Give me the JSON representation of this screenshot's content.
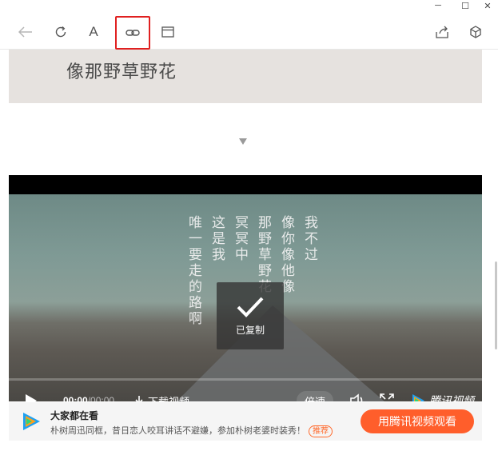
{
  "titlebar": {
    "minimize_glyph": "─",
    "maximize_glyph": "☐",
    "close_glyph": "✕"
  },
  "toolbar": {
    "back_icon": "arrow-left-icon",
    "refresh_icon": "refresh-icon",
    "font_label": "A",
    "link_icon": "link-icon",
    "window_icon": "window-icon",
    "share_icon": "share-icon",
    "cube_icon": "cube-icon",
    "highlight_color": "#e02020"
  },
  "article": {
    "banner_text": "像那野草野花"
  },
  "video": {
    "lyrics": [
      "我不过",
      "像你像他像",
      "那野草野花",
      "冥冥中",
      "这是我",
      "唯一要走的路啊"
    ],
    "toast_text": "已复制",
    "time_current": "00:00",
    "time_sep": "/",
    "time_total": "00:00",
    "download_label": "下载视频",
    "speed_label": "倍速",
    "brand_label": "腾讯视频"
  },
  "promo": {
    "title": "大家都在看",
    "description": "朴树周迅同框，昔日恋人咬耳讲话不避嫌，参加朴树老婆时装秀！",
    "tag": "推荐",
    "button_label": "用腾讯视频观看",
    "button_color": "#ff5e2b"
  }
}
